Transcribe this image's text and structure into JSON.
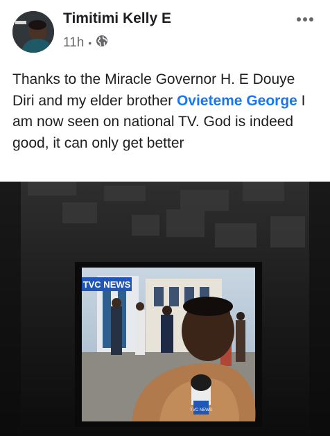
{
  "post": {
    "author": "Timitimi Kelly E",
    "time": "11h",
    "separator": "•",
    "privacy_icon": "globe-icon",
    "more_icon": "more-options-icon",
    "text": {
      "part1": "Thanks to the Miracle Governor H. E Douye Diri  and my elder brother ",
      "mention": "Ovieteme George",
      "part2": " I am now seen on national TV. God is indeed good, it can only get better"
    }
  },
  "photo": {
    "tv_logo": "TVC NEWS",
    "mic_label": "TVC NEWS"
  },
  "colors": {
    "text": "#1c1e21",
    "secondary": "#65676b",
    "link": "#1877f2",
    "tvc_blue": "#1f56b8"
  }
}
